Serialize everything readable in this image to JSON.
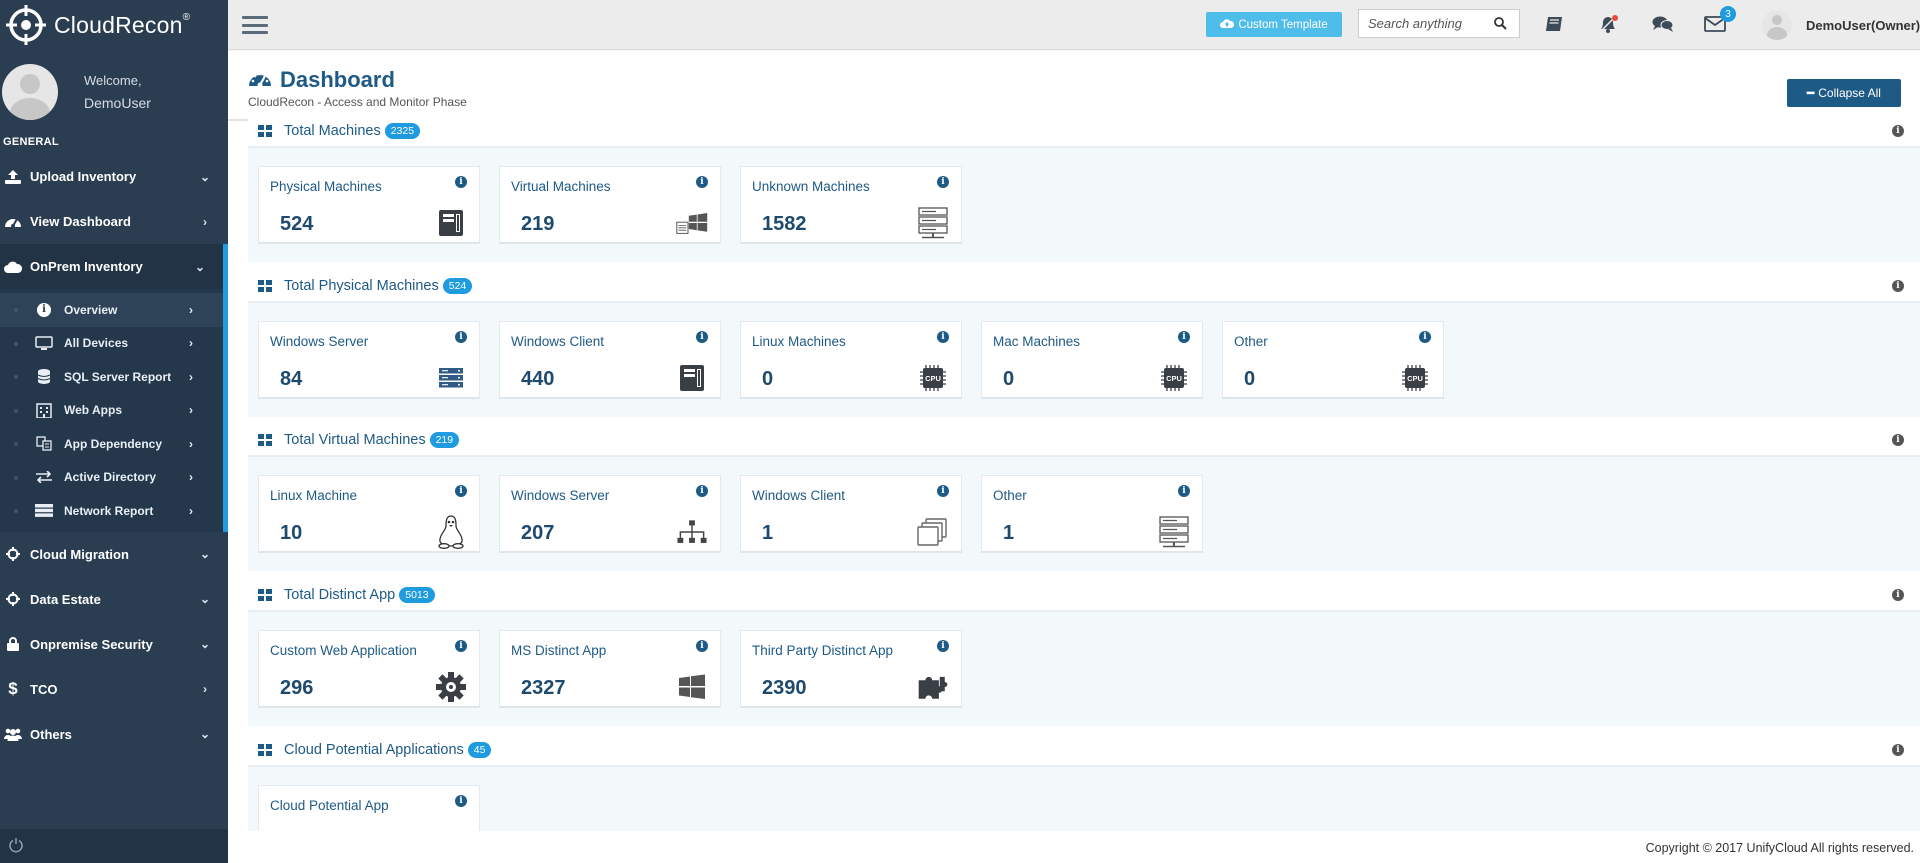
{
  "app": {
    "name": "CloudRecon",
    "trademark": "®"
  },
  "profile": {
    "welcome": "Welcome,",
    "name": "DemoUser"
  },
  "sidebar": {
    "section_label": "GENERAL",
    "items": [
      {
        "label": "Upload Inventory",
        "icon": "upload-icon",
        "chevron": "down"
      },
      {
        "label": "View Dashboard",
        "icon": "dashboard-icon",
        "chevron": "right"
      },
      {
        "label": "OnPrem Inventory",
        "icon": "cloud-icon",
        "chevron": "down"
      },
      {
        "label": "Cloud Migration",
        "icon": "crosshair-icon",
        "chevron": "down"
      },
      {
        "label": "Data Estate",
        "icon": "crosshair-icon",
        "chevron": "down"
      },
      {
        "label": "Onpremise Security",
        "icon": "lock-icon",
        "chevron": "down"
      },
      {
        "label": "TCO",
        "icon": "dollar-icon",
        "chevron": "right"
      },
      {
        "label": "Others",
        "icon": "users-icon",
        "chevron": "down"
      }
    ],
    "subitems": [
      {
        "label": "Overview",
        "icon": "info-icon"
      },
      {
        "label": "All Devices",
        "icon": "monitor-icon"
      },
      {
        "label": "SQL Server Report",
        "icon": "database-icon"
      },
      {
        "label": "Web Apps",
        "icon": "building-icon"
      },
      {
        "label": "App Dependency",
        "icon": "dependency-icon"
      },
      {
        "label": "Active Directory",
        "icon": "exchange-icon"
      },
      {
        "label": "Network Report",
        "icon": "server-icon"
      }
    ]
  },
  "topbar": {
    "custom_template_label": "Custom Template",
    "search_placeholder": "Search anything",
    "mail_count": "3",
    "user_name": "DemoUser(Owner)"
  },
  "page": {
    "title": "Dashboard",
    "subtitle": "CloudRecon - Access and Monitor Phase",
    "collapse_label": "Collapse All"
  },
  "sections": [
    {
      "title": "Total Machines",
      "badge": "2325",
      "cards": [
        {
          "title": "Physical Machines",
          "value": "524",
          "icon": "desktop-tower-icon"
        },
        {
          "title": "Virtual Machines",
          "value": "219",
          "icon": "windows-server-icon"
        },
        {
          "title": "Unknown Machines",
          "value": "1582",
          "icon": "server-rack-icon"
        }
      ]
    },
    {
      "title": "Total Physical Machines",
      "badge": "524",
      "cards": [
        {
          "title": "Windows Server",
          "value": "84",
          "icon": "server-stack-icon"
        },
        {
          "title": "Windows Client",
          "value": "440",
          "icon": "desktop-tower-icon"
        },
        {
          "title": "Linux Machines",
          "value": "0",
          "icon": "cpu-icon"
        },
        {
          "title": "Mac Machines",
          "value": "0",
          "icon": "cpu-icon"
        },
        {
          "title": "Other",
          "value": "0",
          "icon": "cpu-icon"
        }
      ]
    },
    {
      "title": "Total Virtual Machines",
      "badge": "219",
      "cards": [
        {
          "title": "Linux Machine",
          "value": "10",
          "icon": "linux-icon"
        },
        {
          "title": "Windows Server",
          "value": "207",
          "icon": "network-tree-icon"
        },
        {
          "title": "Windows Client",
          "value": "1",
          "icon": "clone-icon"
        },
        {
          "title": "Other",
          "value": "1",
          "icon": "server-rack-icon"
        }
      ]
    },
    {
      "title": "Total Distinct App",
      "badge": "5013",
      "cards": [
        {
          "title": "Custom Web Application",
          "value": "296",
          "icon": "gear-icon"
        },
        {
          "title": "MS Distinct App",
          "value": "2327",
          "icon": "windows-icon"
        },
        {
          "title": "Third Party Distinct App",
          "value": "2390",
          "icon": "puzzle-icon"
        }
      ]
    },
    {
      "title": "Cloud Potential Applications",
      "badge": "45",
      "cards": [
        {
          "title": "Cloud Potential App",
          "value": "",
          "icon": ""
        }
      ]
    }
  ],
  "footer": {
    "copyright": "Copyright © 2017 UnifyCloud All rights reserved."
  }
}
